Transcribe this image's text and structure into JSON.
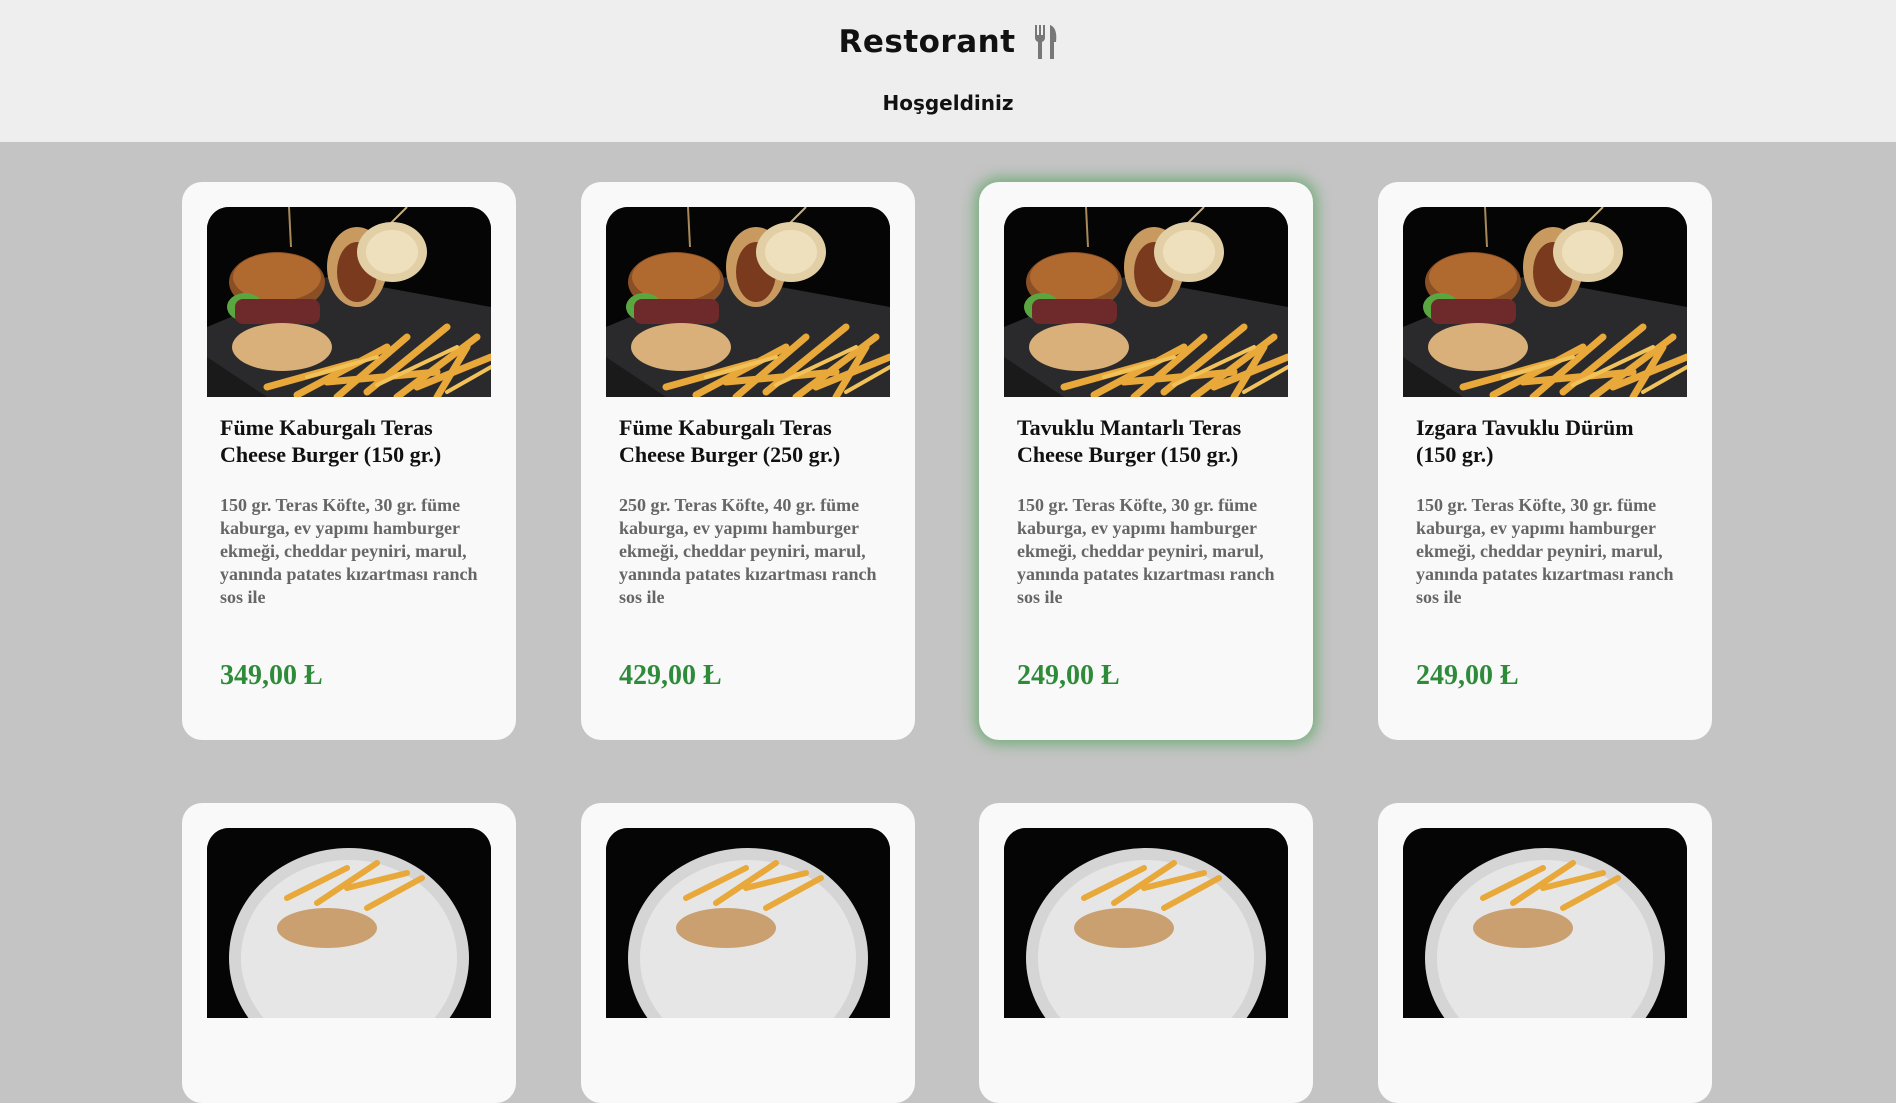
{
  "header": {
    "title": "Restorant",
    "utensils_icon": "fork-knife-icon",
    "subtitle": "Hoşgeldiniz"
  },
  "colors": {
    "header_bg": "#eeeeee",
    "page_bg": "#c4c4c4",
    "card_bg": "#f9f9f9",
    "price": "#2e8b3a",
    "highlight_glow": "#46a050"
  },
  "menu": [
    {
      "name": "Füme Kaburgalı Teras Cheese Burger (150 gr.)",
      "description": "150 gr. Teras Köfte, 30 gr. füme kaburga, ev yapımı hamburger ekmeği, cheddar peyniri, marul, yanında patates kızartması ranch sos ile",
      "price": "349,00 Ł",
      "image": "burger-fries-photo"
    },
    {
      "name": "Füme Kaburgalı Teras Cheese Burger (250 gr.)",
      "description": "250 gr. Teras Köfte, 40 gr. füme kaburga, ev yapımı hamburger ekmeği, cheddar peyniri, marul, yanında patates kızartması ranch sos ile",
      "price": "429,00 Ł",
      "image": "burger-fries-photo"
    },
    {
      "name": "Tavuklu Mantarlı Teras Cheese Burger (150 gr.)",
      "description": "150 gr. Teras Köfte, 30 gr. füme kaburga, ev yapımı hamburger ekmeği, cheddar peyniri, marul, yanında patates kızartması ranch sos ile",
      "price": "249,00 Ł",
      "image": "burger-fries-photo",
      "highlighted": true
    },
    {
      "name": "Izgara Tavuklu Dürüm (150 gr.)",
      "description": "150 gr. Teras Köfte, 30 gr. füme kaburga, ev yapımı hamburger ekmeği, cheddar peyniri, marul, yanında patates kızartması ranch sos ile",
      "price": "249,00 Ł",
      "image": "burger-fries-photo"
    },
    {
      "image": "plate-fries-photo"
    },
    {
      "image": "plate-fries-photo"
    },
    {
      "image": "plate-fries-photo"
    },
    {
      "image": "plate-fries-photo"
    }
  ]
}
